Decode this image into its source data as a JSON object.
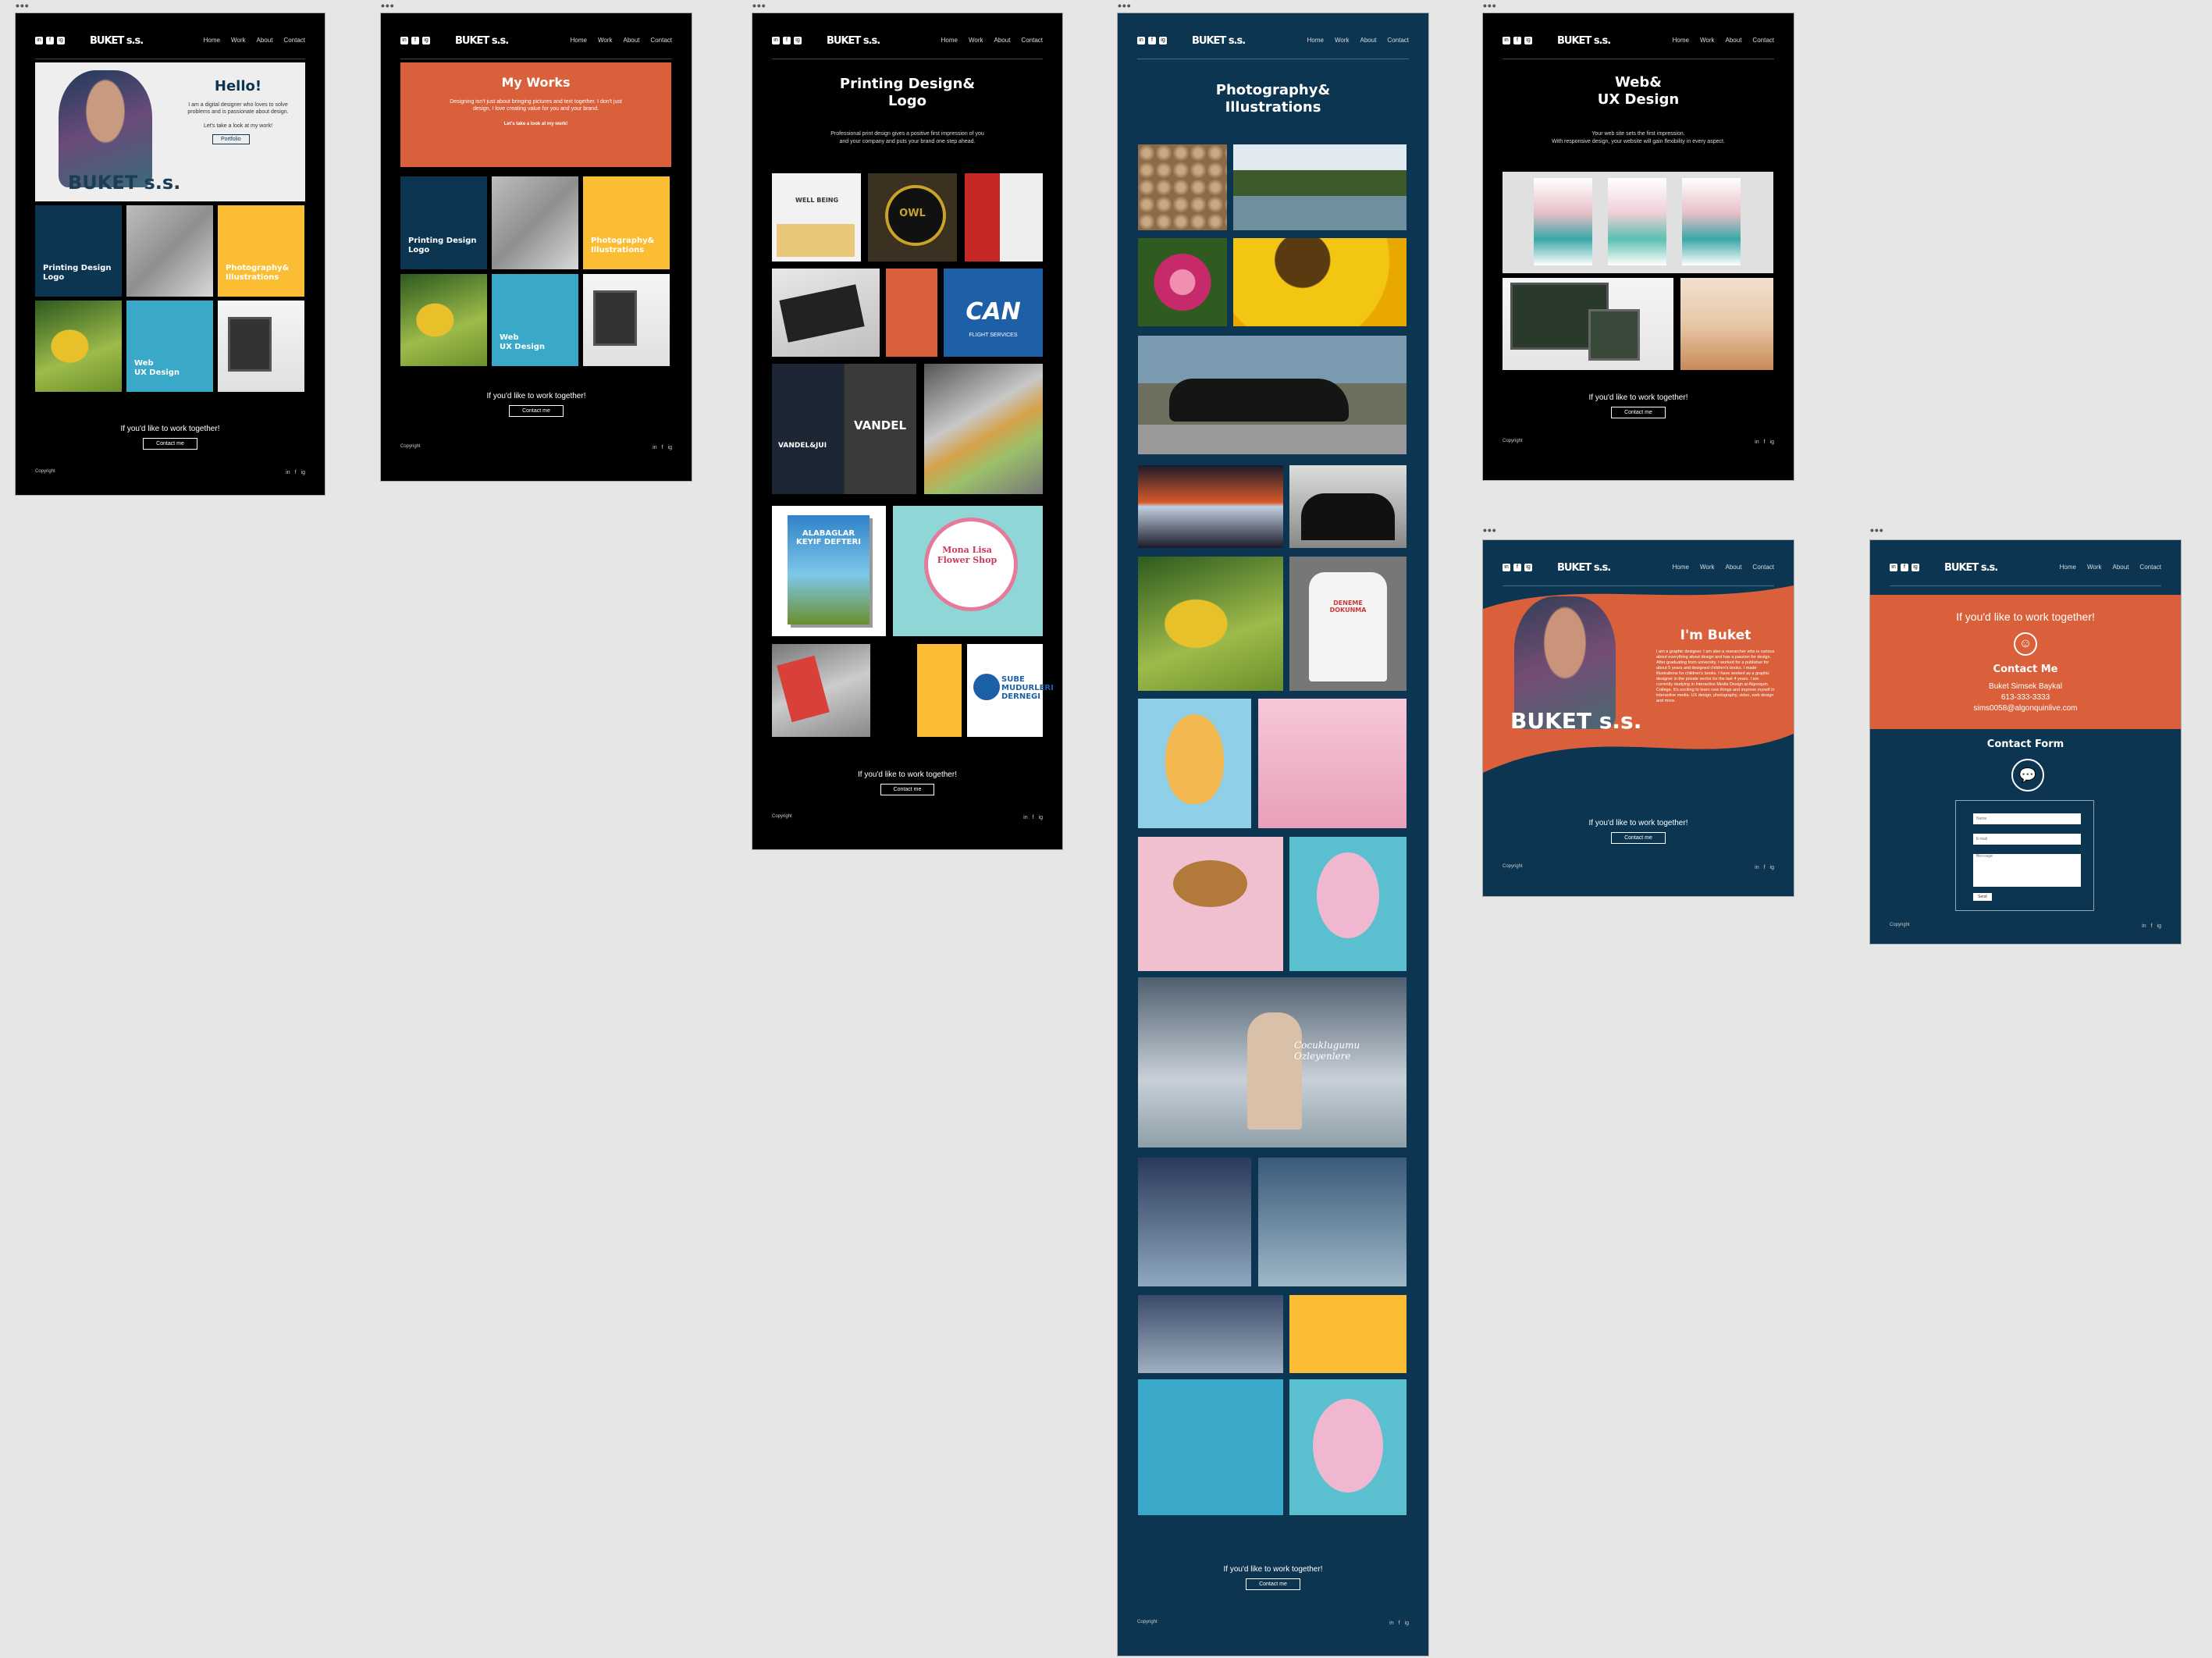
{
  "nav": {
    "logo": "BUKET s.s.",
    "menu": [
      "Home",
      "Work",
      "About",
      "Contact"
    ],
    "social": [
      "in",
      "f",
      "ig"
    ]
  },
  "common": {
    "cta": "If you'd like to work together!",
    "contact_btn": "Contact me",
    "copyright": "Copyright",
    "footer_social": [
      "in",
      "f",
      "ig"
    ]
  },
  "colors": {
    "black": "#000000",
    "navy": "#0b3550",
    "orange": "#d9603a",
    "yellow": "#fbbd33",
    "teal": "#3aa8c8"
  },
  "home": {
    "hero_title": "Hello!",
    "hero_text": "I am a digital designer who loves to solve problems and is passionate about design.",
    "hero_link": "Let's take a look at my work!",
    "portfolio_btn": "Portfolio",
    "hero_brand": "BUKET s.s.",
    "tiles": [
      "Printing Design\nLogo",
      "Photography&\nIllustrations",
      "Web\nUX Design"
    ]
  },
  "works": {
    "title": "My Works",
    "text": "Designing isn't just about bringing pictures and text together. I don't just design, I love creating value for you and your brand.",
    "link": "Let's take a look at my work!",
    "tiles": [
      "Printing Design\nLogo",
      "Photography&\nIllustrations",
      "Web\nUX Design"
    ]
  },
  "printing": {
    "title": "Printing Design&\nLogo",
    "text": "Professional print design gives a positive first impression of you\nand your company and puts your brand one step ahead.",
    "labels": [
      "WELL BEING",
      "OWL",
      "CAN",
      "FLIGHT SERVICES",
      "VANDEL&JUI",
      "VANDEL",
      "ALABAGLAR KEYIF DEFTERI",
      "Mona Lisa Flower Shop",
      "SUBE MUDURLERI DERNEGI"
    ]
  },
  "photo": {
    "title": "Photography&\nIllustrations",
    "labels": [
      "DENEME DOKUNMA",
      "Cocuklugumu Ozleyenlere"
    ]
  },
  "web": {
    "title": "Web&\nUX Design",
    "text": "Your web site sets the first impression.\nWith responsive design, your website will gain flexibility in every aspect."
  },
  "about": {
    "title": "I'm Buket",
    "text": "I am a graphic designer. I am also a researcher who is curious about everything about design and has a passion for design. After graduating from university, I worked for a publisher for about 5 years and designed children's books. I made illustrations for children's books. I have worked as a graphic designer in the private sector for the last 4 years. I am currently studying in Interactive Media Design at Algonquin College. It's exciting to learn new things and improve myself in interactive media. UX design, photography, video, web design and more.",
    "brand": "BUKET s.s."
  },
  "contact": {
    "cta": "If you'd like to work together!",
    "title": "Contact Me",
    "name": "Buket Simsek Baykal",
    "phone": "613-333-3333",
    "email": "sims0058@algonquinlive.com",
    "form_title": "Contact Form",
    "fields": [
      "Name",
      "E-mail",
      "Message"
    ],
    "send": "Send"
  }
}
